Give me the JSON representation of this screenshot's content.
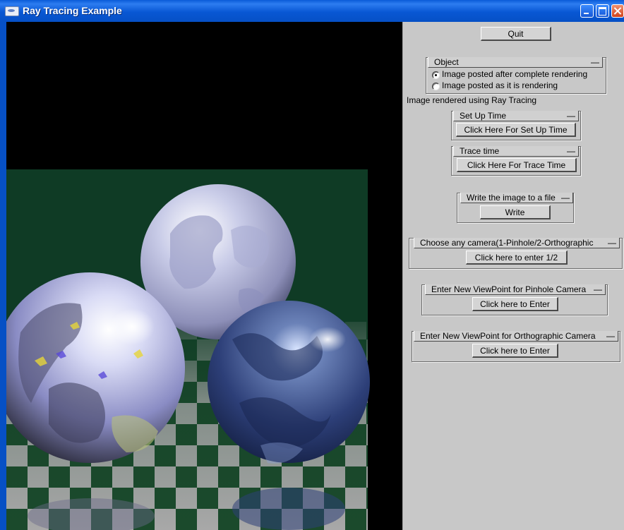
{
  "window": {
    "title": "Ray Tracing Example"
  },
  "panel": {
    "quit_label": "Quit",
    "object_group": {
      "title": "Object",
      "collapse": "—",
      "options": [
        {
          "label": "Image posted after complete rendering",
          "selected": true
        },
        {
          "label": "Image posted as it is rendering",
          "selected": false
        }
      ]
    },
    "status_text": "Image rendered using Ray Tracing",
    "setup_group": {
      "title": "Set Up Time",
      "collapse": "—",
      "button": "Click Here For Set Up Time"
    },
    "trace_group": {
      "title": "Trace time",
      "collapse": "—",
      "button": "Click Here For Trace Time"
    },
    "write_group": {
      "title": "Write the image to a file",
      "collapse": "—",
      "button": "Write"
    },
    "camera_group": {
      "title": "Choose any camera(1-Pinhole/2-Orthographic",
      "collapse": "—",
      "button": "Click here to enter 1/2"
    },
    "pinhole_group": {
      "title": "Enter New ViewPoint for Pinhole Camera",
      "collapse": "—",
      "button": "Click here to Enter"
    },
    "ortho_group": {
      "title": "Enter New ViewPoint for Orthographic Camera",
      "collapse": "—",
      "button": "Click here to Enter"
    }
  },
  "colors": {
    "backdrop": "#0f3b25",
    "checker_light": "#a8a8a8",
    "checker_dark": "#1b4a2c",
    "panel_bg": "#c8c8c8",
    "titlebar": "#0a5bd8"
  }
}
